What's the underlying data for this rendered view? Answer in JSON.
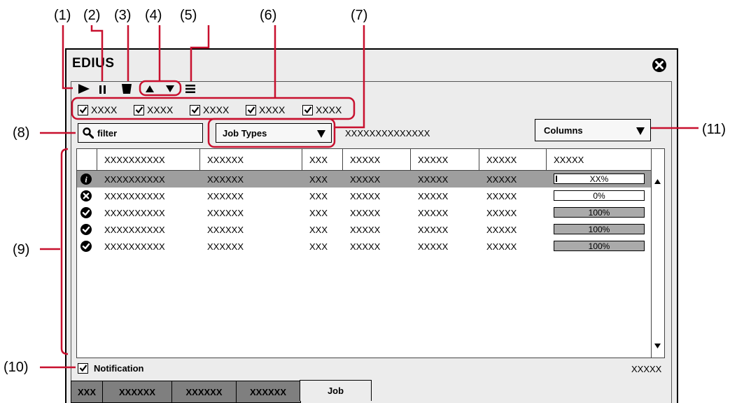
{
  "callouts": [
    "(1)",
    "(2)",
    "(3)",
    "(4)",
    "(5)",
    "(6)",
    "(7)",
    "(8)",
    "(9)",
    "(10)",
    "(11)"
  ],
  "window": {
    "title": "EDIUS"
  },
  "toolbar": {
    "icons": [
      "play-icon",
      "pause-icon",
      "delete-icon",
      "move-up-icon",
      "move-down-icon",
      "menu-icon"
    ]
  },
  "filters": {
    "checks": [
      {
        "label": "XXXX",
        "checked": true
      },
      {
        "label": "XXXX",
        "checked": true
      },
      {
        "label": "XXXX",
        "checked": true
      },
      {
        "label": "XXXX",
        "checked": true
      },
      {
        "label": "XXXX",
        "checked": true
      }
    ]
  },
  "filter_field": {
    "label": "filter"
  },
  "job_types": {
    "label": "Job Types"
  },
  "count_text": "XXXXXXXXXXXXXX",
  "columns_dropdown": {
    "label": "Columns"
  },
  "table": {
    "headers": [
      "XXXXXXXXXX",
      "XXXXXX",
      "XXX",
      "XXXXX",
      "XXXXX",
      "XXXXX",
      "XXXXX"
    ],
    "rows": [
      {
        "status": "info",
        "cells": [
          "XXXXXXXXXX",
          "XXXXXX",
          "XXX",
          "XXXXX",
          "XXXXX",
          "XXXXX"
        ],
        "progress_text": "XX%",
        "progress": 0.02,
        "selected": true
      },
      {
        "status": "error",
        "cells": [
          "XXXXXXXXXX",
          "XXXXXX",
          "XXX",
          "XXXXX",
          "XXXXX",
          "XXXXX"
        ],
        "progress_text": "0%",
        "progress": 0,
        "selected": false
      },
      {
        "status": "done",
        "cells": [
          "XXXXXXXXXX",
          "XXXXXX",
          "XXX",
          "XXXXX",
          "XXXXX",
          "XXXXX"
        ],
        "progress_text": "100%",
        "progress": 1,
        "selected": false
      },
      {
        "status": "done",
        "cells": [
          "XXXXXXXXXX",
          "XXXXXX",
          "XXX",
          "XXXXX",
          "XXXXX",
          "XXXXX"
        ],
        "progress_text": "100%",
        "progress": 1,
        "selected": false
      },
      {
        "status": "done",
        "cells": [
          "XXXXXXXXXX",
          "XXXXXX",
          "XXX",
          "XXXXX",
          "XXXXX",
          "XXXXX"
        ],
        "progress_text": "100%",
        "progress": 1,
        "selected": false
      }
    ]
  },
  "notification": {
    "label": "Notification",
    "checked": true
  },
  "footer_status": "XXXXX",
  "tabs": [
    "XXX",
    "XXXXXX",
    "XXXXXX",
    "XXXXXX",
    "Job"
  ],
  "active_tab": "Job"
}
